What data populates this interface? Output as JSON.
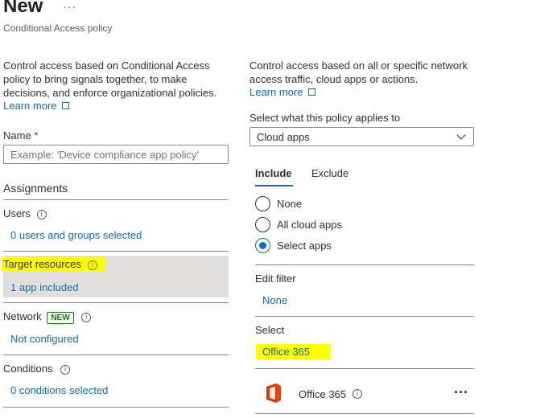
{
  "header": {
    "title": "New",
    "more": "···",
    "subtitle": "Conditional Access policy"
  },
  "left": {
    "intro": "Control access based on Conditional Access policy to bring signals together, to make decisions, and enforce organizational policies.",
    "learn_more": "Learn more",
    "name_label": "Name",
    "name_required": "*",
    "name_placeholder": "Example: 'Device compliance app policy'",
    "assignments": "Assignments",
    "users": {
      "label": "Users",
      "value": "0 users and groups selected"
    },
    "target_resources": {
      "label": "Target resources",
      "value": "1 app included"
    },
    "network": {
      "label": "Network",
      "badge": "NEW",
      "value": "Not configured"
    },
    "conditions": {
      "label": "Conditions",
      "value": "0 conditions selected"
    }
  },
  "right": {
    "intro": "Control access based on all or specific network access traffic, cloud apps or actions.",
    "learn_more": "Learn more",
    "applies_label": "Select what this policy applies to",
    "applies_value": "Cloud apps",
    "tabs": [
      "Include",
      "Exclude"
    ],
    "radios": [
      "None",
      "All cloud apps",
      "Select apps"
    ],
    "selected_radio": "Select apps",
    "edit_filter_label": "Edit filter",
    "edit_filter_value": "None",
    "select_label": "Select",
    "select_value": "Office 365",
    "app_name": "Office 365",
    "app_more": "···"
  },
  "colors": {
    "accent": "#0f6cbd",
    "highlight": "#ffff00",
    "selected_bg": "#e1dfdd",
    "badge_green": "#107c10"
  }
}
